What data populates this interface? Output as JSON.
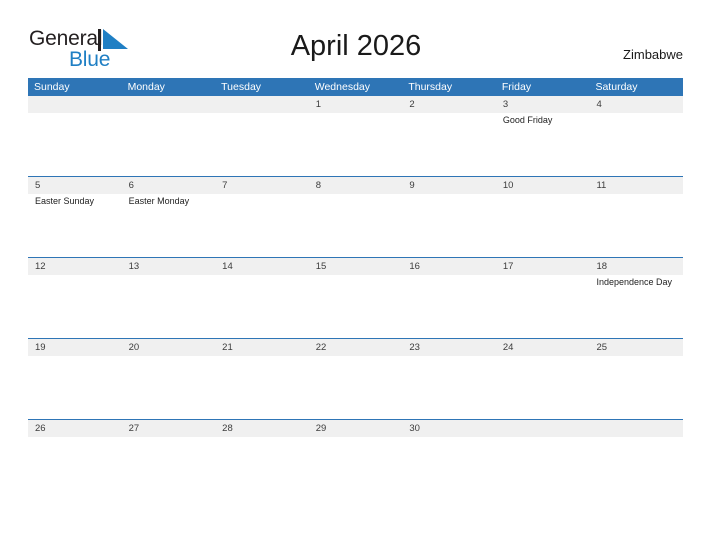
{
  "brand": {
    "name_part1": "General",
    "name_part2": "Blue",
    "flag_icon": "flag-triangle-icon",
    "color_dark": "#231f20",
    "color_blue": "#1f7fc4"
  },
  "header": {
    "title": "April 2026",
    "region": "Zimbabwe"
  },
  "calendar": {
    "header_bg": "#2e75b6",
    "date_band_bg": "#f0f0f0",
    "weekdays": [
      "Sunday",
      "Monday",
      "Tuesday",
      "Wednesday",
      "Thursday",
      "Friday",
      "Saturday"
    ],
    "weeks": [
      {
        "days": [
          {
            "date": "",
            "event": ""
          },
          {
            "date": "",
            "event": ""
          },
          {
            "date": "",
            "event": ""
          },
          {
            "date": "1",
            "event": ""
          },
          {
            "date": "2",
            "event": ""
          },
          {
            "date": "3",
            "event": "Good Friday"
          },
          {
            "date": "4",
            "event": ""
          }
        ]
      },
      {
        "days": [
          {
            "date": "5",
            "event": "Easter Sunday"
          },
          {
            "date": "6",
            "event": "Easter Monday"
          },
          {
            "date": "7",
            "event": ""
          },
          {
            "date": "8",
            "event": ""
          },
          {
            "date": "9",
            "event": ""
          },
          {
            "date": "10",
            "event": ""
          },
          {
            "date": "11",
            "event": ""
          }
        ]
      },
      {
        "days": [
          {
            "date": "12",
            "event": ""
          },
          {
            "date": "13",
            "event": ""
          },
          {
            "date": "14",
            "event": ""
          },
          {
            "date": "15",
            "event": ""
          },
          {
            "date": "16",
            "event": ""
          },
          {
            "date": "17",
            "event": ""
          },
          {
            "date": "18",
            "event": "Independence Day"
          }
        ]
      },
      {
        "days": [
          {
            "date": "19",
            "event": ""
          },
          {
            "date": "20",
            "event": ""
          },
          {
            "date": "21",
            "event": ""
          },
          {
            "date": "22",
            "event": ""
          },
          {
            "date": "23",
            "event": ""
          },
          {
            "date": "24",
            "event": ""
          },
          {
            "date": "25",
            "event": ""
          }
        ]
      },
      {
        "days": [
          {
            "date": "26",
            "event": ""
          },
          {
            "date": "27",
            "event": ""
          },
          {
            "date": "28",
            "event": ""
          },
          {
            "date": "29",
            "event": ""
          },
          {
            "date": "30",
            "event": ""
          },
          {
            "date": "",
            "event": ""
          },
          {
            "date": "",
            "event": ""
          }
        ]
      }
    ]
  }
}
